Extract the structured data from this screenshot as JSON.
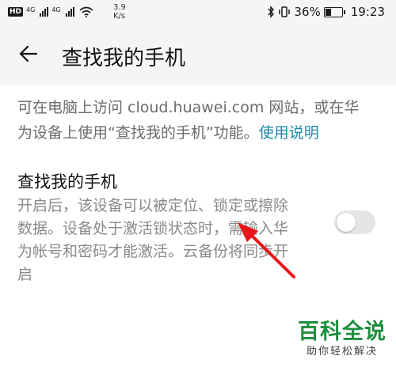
{
  "status_bar": {
    "hd_label": "HD",
    "net1": "4G",
    "net2": "4G",
    "speed_value": "3.9",
    "speed_unit": "K/s",
    "battery": "36%",
    "time": "19:23"
  },
  "header": {
    "back_icon": "arrow-left-icon",
    "title": "查找我的手机"
  },
  "intro": {
    "text": "可在电脑上访问 cloud.huawei.com 网站，或在华为设备上使用“查找我的手机”功能。",
    "link": "使用说明"
  },
  "setting": {
    "title": "查找我的手机",
    "description": "开启后，该设备可以被定位、锁定或擦除数据。设备处于激活锁状态时，需输入华为帐号和密码才能激活。云备份将同步开启",
    "toggle_on": false
  },
  "annotation": {
    "color": "#e8151b"
  },
  "watermark": {
    "title": "百科全说",
    "subtitle": "助你轻松解决",
    "color": "#1d8f3d"
  }
}
